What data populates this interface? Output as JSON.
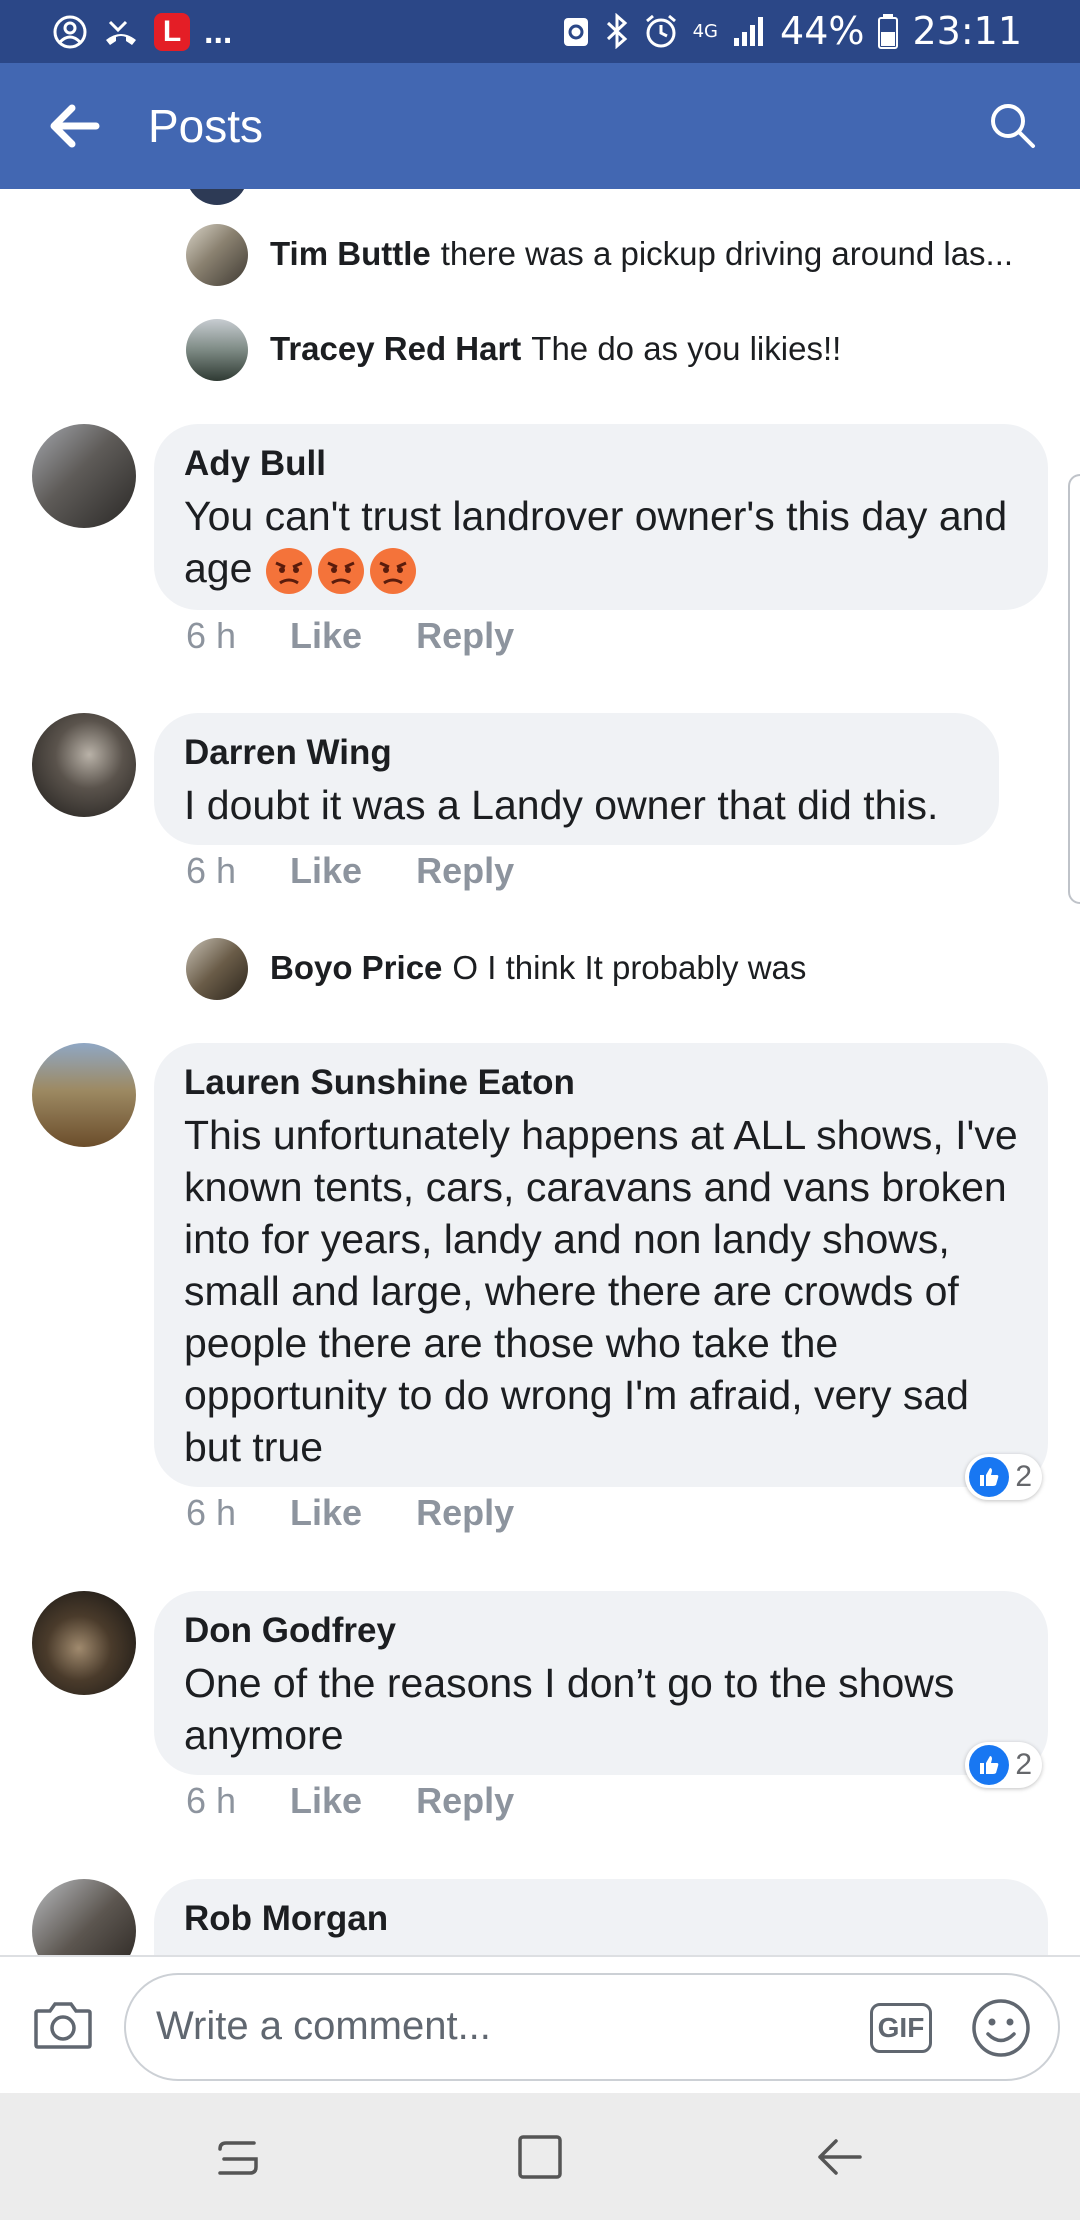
{
  "status_bar": {
    "notification_more": "...",
    "network": "4G",
    "battery": "44%",
    "time": "23:11"
  },
  "app_bar": {
    "title": "Posts"
  },
  "comments": [
    {
      "type": "reply",
      "name": "Tim Buttle",
      "text": "there was a pickup driving around las..."
    },
    {
      "type": "reply",
      "name": "Tracey Red Hart",
      "text": "The do as you likies!!"
    },
    {
      "type": "comment",
      "name": "Ady Bull",
      "text": "You can't trust landrover owner's this day and age",
      "emoji_count": 3,
      "time": "6 h",
      "like": "Like",
      "reply": "Reply"
    },
    {
      "type": "comment",
      "name": "Darren Wing",
      "text": "I doubt it was a Landy owner that did this.",
      "time": "6 h",
      "like": "Like",
      "reply": "Reply"
    },
    {
      "type": "reply",
      "name": "Boyo Price",
      "text": "O I think It probably was"
    },
    {
      "type": "comment",
      "name": "Lauren Sunshine Eaton",
      "text": "This unfortunately happens at ALL shows, I've known tents, cars, caravans and vans broken into for years, landy and non landy shows, small and large, where there are crowds of people there are those who take the opportunity to do wrong I'm afraid, very sad but true",
      "time": "6 h",
      "like": "Like",
      "reply": "Reply",
      "reactions": "2"
    },
    {
      "type": "comment",
      "name": "Don Godfrey",
      "text": "One of the reasons I don’t go to the shows anymore",
      "time": "6 h",
      "like": "Like",
      "reply": "Reply",
      "reactions": "2"
    },
    {
      "type": "comment",
      "name": "Rob Morgan"
    }
  ],
  "composer": {
    "placeholder": "Write a comment...",
    "gif_label": "GIF"
  },
  "colors": {
    "status_bar": "#2b4787",
    "app_bar": "#4267b2",
    "bubble": "#f0f2f5",
    "like_blue": "#1877f2"
  }
}
